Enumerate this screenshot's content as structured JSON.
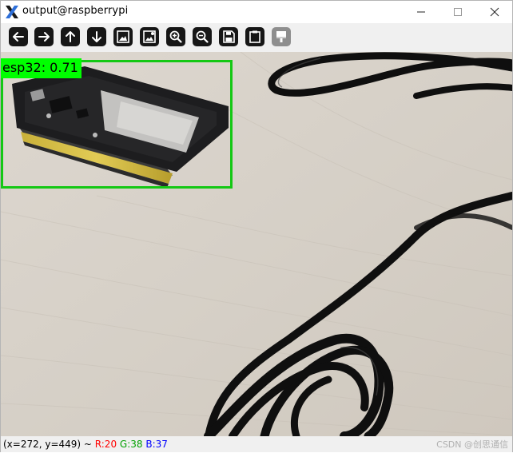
{
  "window": {
    "title": "output@raspberrypi",
    "app_icon": "x-logo-icon",
    "controls": {
      "minimize": "minimize-icon",
      "maximize": "maximize-icon",
      "close": "close-icon"
    }
  },
  "toolbar": {
    "buttons": [
      {
        "name": "pan-left",
        "icon": "arrow-left-icon",
        "enabled": true
      },
      {
        "name": "pan-right",
        "icon": "arrow-right-icon",
        "enabled": true
      },
      {
        "name": "pan-up",
        "icon": "arrow-up-icon",
        "enabled": true
      },
      {
        "name": "pan-down",
        "icon": "arrow-down-icon",
        "enabled": true
      },
      {
        "name": "zoom-image",
        "icon": "image-icon",
        "enabled": true
      },
      {
        "name": "zoom-image-alt",
        "icon": "image-settings-icon",
        "enabled": true
      },
      {
        "name": "zoom-in",
        "icon": "zoom-in-icon",
        "enabled": true
      },
      {
        "name": "zoom-out",
        "icon": "zoom-out-icon",
        "enabled": true
      },
      {
        "name": "save",
        "icon": "save-icon",
        "enabled": true
      },
      {
        "name": "copy",
        "icon": "clipboard-icon",
        "enabled": true
      },
      {
        "name": "properties",
        "icon": "brush-icon",
        "enabled": false
      }
    ]
  },
  "detection": {
    "label": "esp32: 0.71",
    "box_color": "#14c814",
    "label_bg": "#00ff00"
  },
  "statusbar": {
    "coords": "(x=272, y=449) ~ ",
    "r": "R:20",
    "g": "G:38",
    "b": "B:37",
    "watermark": "CSDN @创思通信"
  }
}
